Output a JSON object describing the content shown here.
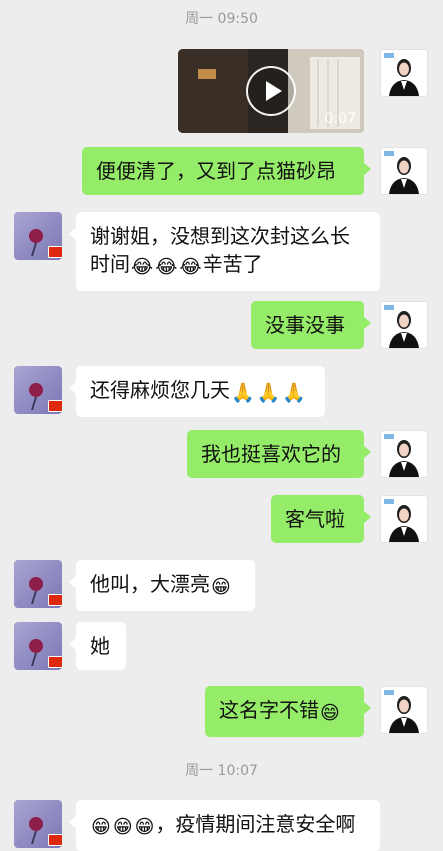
{
  "timestamps": {
    "first": "周一 09:50",
    "second": "周一 10:07"
  },
  "video": {
    "duration": "0:07"
  },
  "messages": {
    "m1": "便便清了，又到了点猫砂昂",
    "m2_line1": "谢谢姐，没想到这次封这么长",
    "m2_line2_prefix": "时间",
    "m2_line2_suffix": "辛苦了",
    "m3": "没事没事",
    "m4_text": "还得麻烦您几天",
    "m5": "我也挺喜欢它的",
    "m6": "客气啦",
    "m7_text": "他叫，大漂亮",
    "m8": "她",
    "m9_text": "这名字不错",
    "m10_text": "，疫情期间注意安全啊"
  },
  "emoji": {
    "laugh_tears": "😂",
    "pray": "🙏",
    "grin": "😁",
    "smile": "😄"
  }
}
